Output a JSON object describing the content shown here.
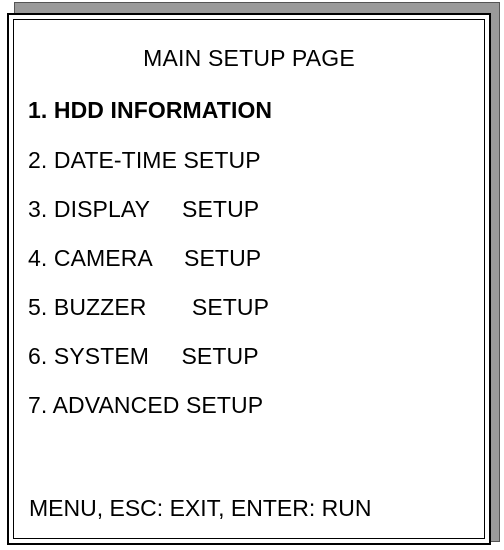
{
  "menu": {
    "title": "MAIN SETUP PAGE",
    "items": [
      {
        "label": "1. HDD INFORMATION",
        "selected": true
      },
      {
        "label": "2. DATE-TIME SETUP",
        "selected": false
      },
      {
        "label": "3. DISPLAY     SETUP",
        "selected": false
      },
      {
        "label": "4. CAMERA     SETUP",
        "selected": false
      },
      {
        "label": "5. BUZZER       SETUP",
        "selected": false
      },
      {
        "label": "6. SYSTEM     SETUP",
        "selected": false
      },
      {
        "label": "7. ADVANCED SETUP",
        "selected": false
      }
    ],
    "footer": "MENU, ESC: EXIT, ENTER: RUN"
  }
}
